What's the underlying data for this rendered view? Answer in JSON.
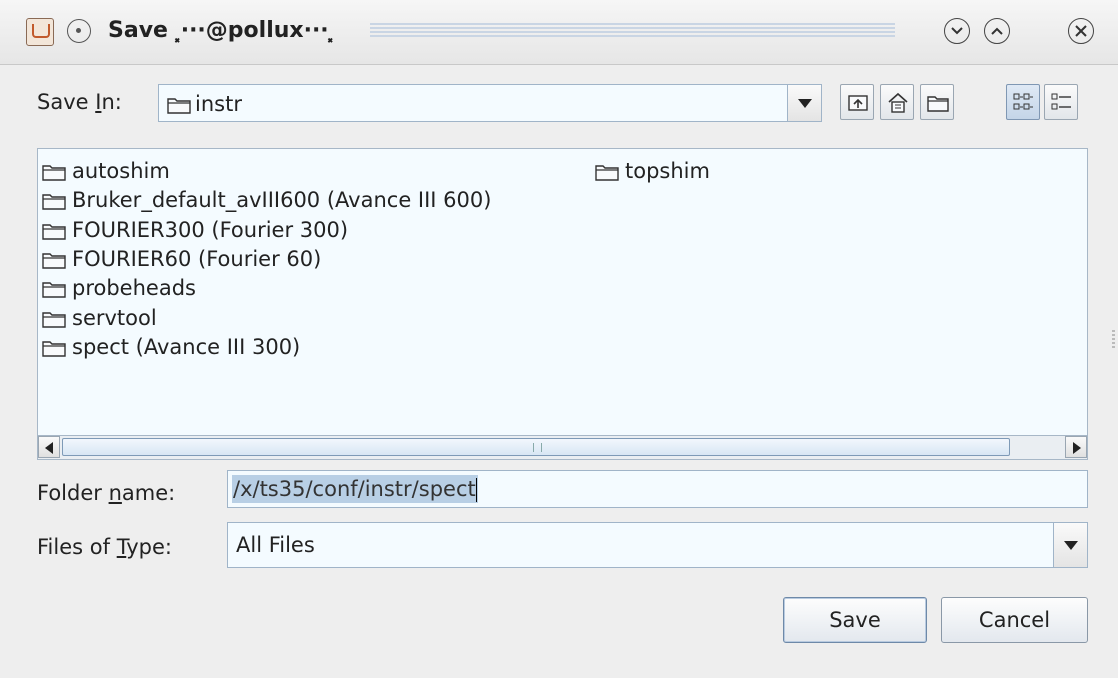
{
  "window": {
    "title": "Save ⸼···@pollux···⸼",
    "buttons": [
      "minimize",
      "maximize",
      "close"
    ]
  },
  "save_in": {
    "label_pre": "Save ",
    "label_mnemonic": "I",
    "label_post": "n:",
    "value": "instr"
  },
  "toolbar": {
    "items": [
      "up-one-level",
      "home",
      "new-folder",
      "list-view",
      "details-view"
    ],
    "active": "list-view"
  },
  "file_list": {
    "column1": [
      "autoshim",
      "Bruker_default_avIII600 (Avance III 600)",
      "FOURIER300 (Fourier 300)",
      "FOURIER60 (Fourier 60)",
      "probeheads",
      "servtool",
      "spect (Avance III 300)"
    ],
    "column2": [
      "topshim"
    ]
  },
  "folder_name": {
    "label_pre": "Folder ",
    "label_mnemonic": "n",
    "label_post": "ame:",
    "value": "/x/ts35/conf/instr/spect"
  },
  "files_of_type": {
    "label_pre": "Files of ",
    "label_mnemonic": "T",
    "label_post": "ype:",
    "value": "All Files"
  },
  "actions": {
    "save": "Save",
    "cancel": "Cancel"
  },
  "colors": {
    "field_bg": "#f4fbff",
    "selection": "#b8cfe5",
    "window_bg": "#eeeeee"
  }
}
